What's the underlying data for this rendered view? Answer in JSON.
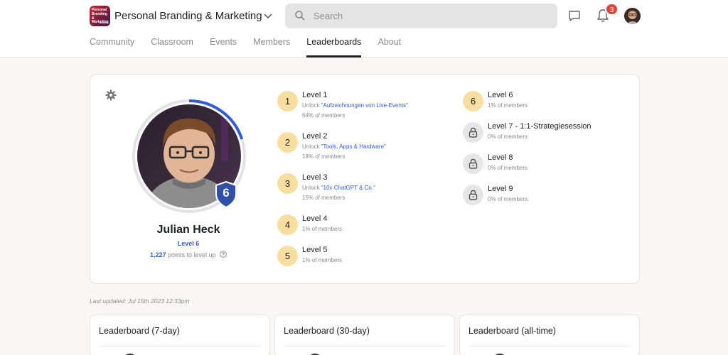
{
  "header": {
    "logo_text": [
      "Personal",
      "Branding",
      "& Marketing",
      "academy"
    ],
    "group_name": "Personal Branding & Marketing",
    "search_placeholder": "Search",
    "notification_count": "3"
  },
  "tabs": [
    {
      "label": "Community",
      "active": false
    },
    {
      "label": "Classroom",
      "active": false
    },
    {
      "label": "Events",
      "active": false
    },
    {
      "label": "Members",
      "active": false
    },
    {
      "label": "Leaderboards",
      "active": true
    },
    {
      "label": "About",
      "active": false
    }
  ],
  "profile": {
    "name": "Julian Heck",
    "level_label": "Level 6",
    "level_number": "6",
    "points": "1,227",
    "points_suffix": "points to level up",
    "level_progress_fraction": 0.2
  },
  "levels_left": [
    {
      "num": "1",
      "title": "Level 1",
      "unlock_prefix": "Unlock ",
      "unlock_link": "\"Aufzeichnungen von Live-Events\"",
      "pct": "64% of members"
    },
    {
      "num": "2",
      "title": "Level 2",
      "unlock_prefix": "Unlock ",
      "unlock_link": "\"Tools, Apps & Hardware\"",
      "pct": "18% of members"
    },
    {
      "num": "3",
      "title": "Level 3",
      "unlock_prefix": "Unlock ",
      "unlock_link": "\"10x ChatGPT & Co.\"",
      "pct": "15% of members"
    },
    {
      "num": "4",
      "title": "Level 4",
      "pct": "1% of members"
    },
    {
      "num": "5",
      "title": "Level 5",
      "pct": "1% of members"
    }
  ],
  "levels_right": [
    {
      "num": "6",
      "title": "Level 6",
      "pct": "1% of members",
      "locked": false
    },
    {
      "num": "",
      "title": "Level 7 - 1:1-Strategiesession",
      "pct": "0% of members",
      "locked": true
    },
    {
      "num": "",
      "title": "Level 8",
      "pct": "0% of members",
      "locked": true
    },
    {
      "num": "",
      "title": "Level 9",
      "pct": "0% of members",
      "locked": true
    }
  ],
  "last_updated": "Last updated: Jul 15th 2023 12:33pm",
  "leaderboards": [
    {
      "title": "Leaderboard (7-day)"
    },
    {
      "title": "Leaderboard (30-day)"
    },
    {
      "title": "Leaderboard (all-time)"
    }
  ],
  "colors": {
    "accent_blue": "#2f5cd7",
    "level_gold": "#f7dfa2",
    "badge_red": "#e4423a"
  }
}
